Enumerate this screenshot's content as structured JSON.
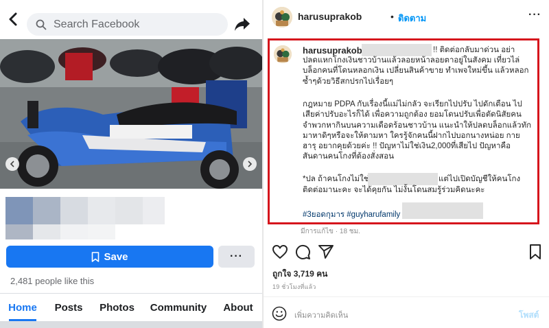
{
  "colors": {
    "fb_blue": "#1877f2",
    "ig_blue": "#0095f6",
    "highlight_red": "#d6141c",
    "redaction_gray": "#e1e1e1"
  },
  "facebook": {
    "search": {
      "placeholder": "Search Facebook",
      "icon": "search-icon"
    },
    "back_icon": "chevron-left-icon",
    "share_icon": "share-arrow-icon",
    "photo": {
      "subject": "parked motorcycles, blue and white scooter in front"
    },
    "save_button": {
      "label": "Save",
      "icon": "bookmark-icon"
    },
    "more_button": {
      "label": "···"
    },
    "likes": "2,481 people like this",
    "tabs": [
      {
        "label": "Home",
        "active": true
      },
      {
        "label": "Posts",
        "active": false
      },
      {
        "label": "Photos",
        "active": false
      },
      {
        "label": "Community",
        "active": false
      },
      {
        "label": "About",
        "active": false
      }
    ]
  },
  "instagram": {
    "header": {
      "username": "harusuprakob",
      "dot": "•",
      "follow": "ติดตาม",
      "menu": "···"
    },
    "caption": {
      "username": "harusuprakob",
      "first_line_suffix": "!! ติดต่อกลับมาด่วน อย่า",
      "para1": "ปลดแหกโกงเงินชาวบ้านแล้วลอยหน้าลอยตาอยู่ในสังคม เที่ยวไล่บล็อกคนที่โดนหลอกเงิน เปลี่ยนสินค้าขาย ทำเพจใหม่ขึ้น แล้วหลอกซ้ำๆด้วยวิธีสกปรกไปเรื่อยๆ",
      "para2": "กฎหมาย PDPA กับเรื่องนี้แม่ไม่กลัว จะเรียกไปปรับ ไปดักเตือน ไปเสียค่าปรับอะไรก็ได้ เพื่อความถูกต้อง ยอมโดนปรับเพื่อตัดนิสัยคนจำพวกหากินบนความเดือดร้อนชาวบ้าน แนะนำให้ปลดบล็อกแล้วทักมาหาดิๆหรือจะให้ตามหา ใครรู้จักคนนี้ฝากไปบอกนางหน่อย กาย ฮารุ อยากคุยด้วยค่ะ !! ปัญหาไม่ใช่เงิน2,000ที่เสียไป ปัญหาคือสันดานคนโกงที่ต้องสั่งสอน",
      "para3_prefix": "*ปล ถ้าคนโกงไม่ใช่",
      "para3_suffix": "แต่ไปเปิดบัญชีให้คนโกง",
      "para3_rest": "ติดต่อมานะคะ จะได้คุยกัน ไม่งั้นโดนสมรู้ร่วมคิดนะคะ",
      "hashtags": "#3ยอดกุมาร #guyharufamily",
      "edited": "มีการแก้ไข · 18 ชม."
    },
    "actions": {
      "like_icon": "heart-icon",
      "comment_icon": "comment-icon",
      "share_icon": "send-icon",
      "save_icon": "bookmark-icon"
    },
    "likes": "ถูกใจ 3,719 คน",
    "time": "19 ชั่วโมงที่แล้ว",
    "comment_placeholder": "เพิ่มความคิดเห็น",
    "post_button": "โพสต์"
  }
}
